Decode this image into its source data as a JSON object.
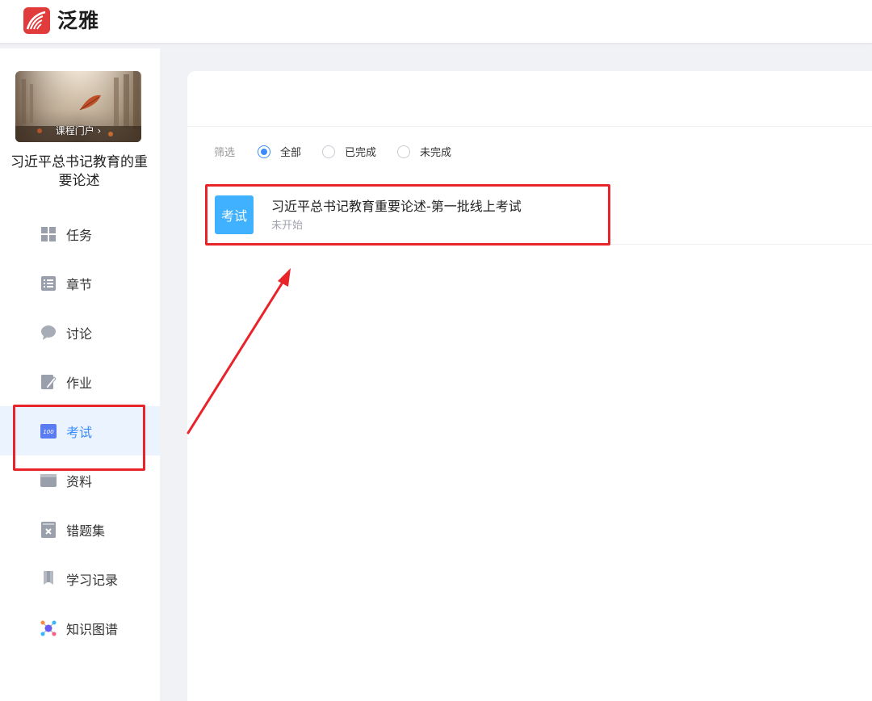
{
  "header": {
    "brand": "泛雅",
    "logo_icon": "chaoxing-logo-icon",
    "brand_color": "#e23b3b"
  },
  "sidebar": {
    "cover_link": "课程门户 ›",
    "course_title": "习近平总书记教育的重要论述",
    "items": [
      {
        "label": "任务",
        "icon": "grid-icon"
      },
      {
        "label": "章节",
        "icon": "list-icon"
      },
      {
        "label": "讨论",
        "icon": "chat-bubble-icon"
      },
      {
        "label": "作业",
        "icon": "edit-doc-icon"
      },
      {
        "label": "考试",
        "icon": "exam-100-icon",
        "active": true
      },
      {
        "label": "资料",
        "icon": "folder-icon"
      },
      {
        "label": "错题集",
        "icon": "wrong-set-icon"
      },
      {
        "label": "学习记录",
        "icon": "bookmark-icon"
      },
      {
        "label": "知识图谱",
        "icon": "knowledge-graph-icon"
      }
    ],
    "active_color": "#3a8bff"
  },
  "main": {
    "filter": {
      "label": "筛选",
      "options": [
        {
          "label": "全部",
          "checked": true
        },
        {
          "label": "已完成",
          "checked": false
        },
        {
          "label": "未完成",
          "checked": false
        }
      ]
    },
    "exams": [
      {
        "badge": "考试",
        "title": "习近平总书记教育重要论述-第一批线上考试",
        "status": "未开始"
      }
    ]
  },
  "annotation_color": "#e8232a"
}
